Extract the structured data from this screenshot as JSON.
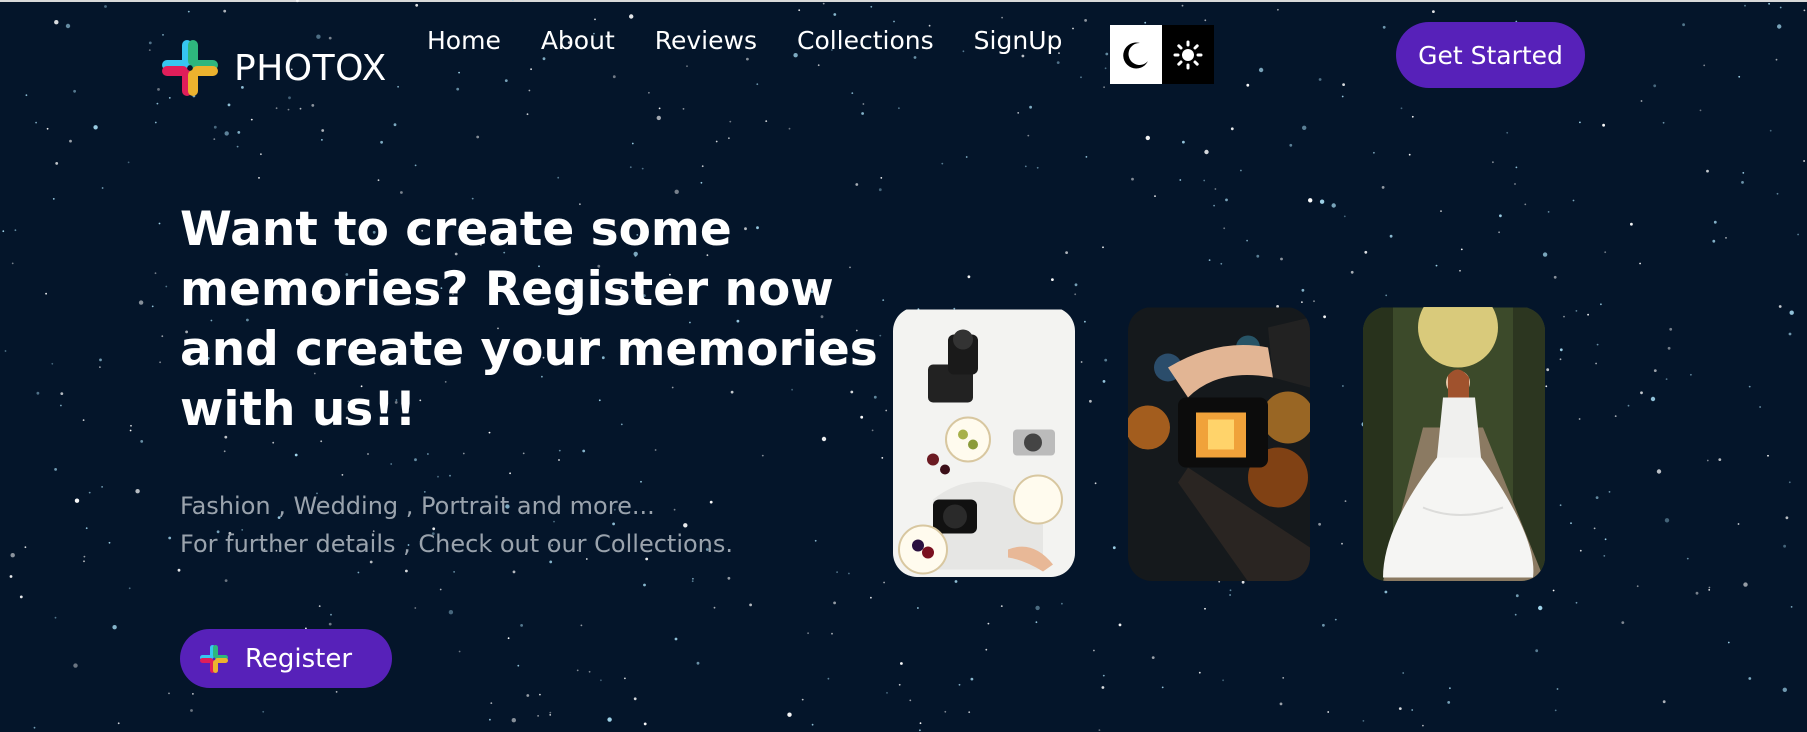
{
  "brand": {
    "name": "PHOTOX",
    "logo_icon": "slack-style-hash-icon"
  },
  "nav": {
    "items": [
      {
        "label": "Home"
      },
      {
        "label": "About"
      },
      {
        "label": "Reviews"
      },
      {
        "label": "Collections"
      },
      {
        "label": "SignUp"
      }
    ]
  },
  "theme_toggle": {
    "dark_icon": "moon-icon",
    "light_icon": "sun-icon"
  },
  "header_cta": {
    "label": "Get Started"
  },
  "hero": {
    "headline": "Want to create some memories? Register now and create your memories with us!!",
    "sub_line_1": "Fashion , Wedding , Portrait and more...",
    "sub_line_2": "For further details , Check out our Collections.",
    "register_label": "Register"
  },
  "gallery": [
    {
      "subject": "cameras-and-plates-flatlay"
    },
    {
      "subject": "hand-holding-camera-bokeh"
    },
    {
      "subject": "bride-in-forest"
    }
  ],
  "colors": {
    "background": "#04152a",
    "accent": "#5721b9",
    "text": "#ffffff",
    "muted_text": "#9aa3ad"
  }
}
